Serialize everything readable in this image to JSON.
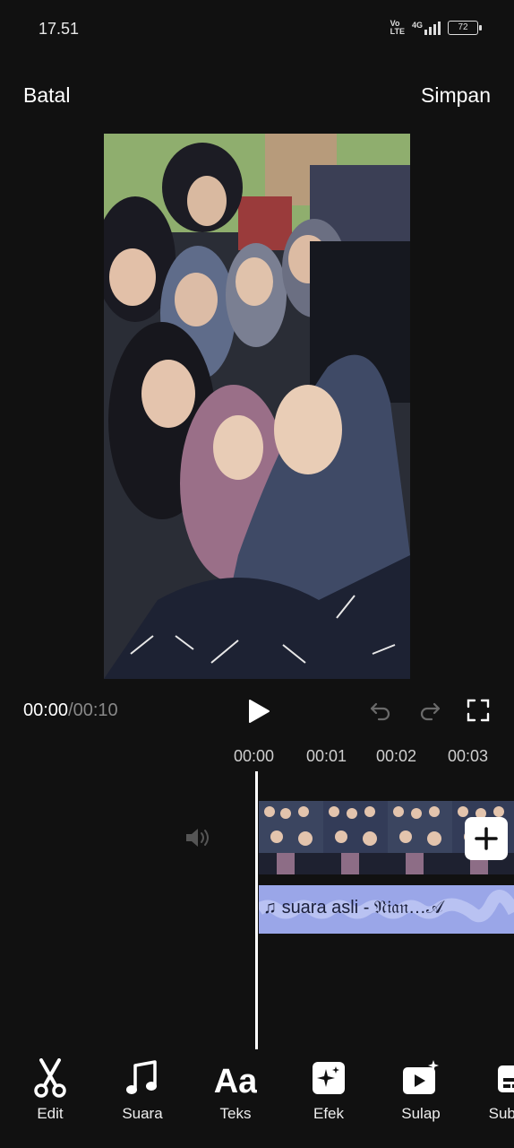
{
  "status": {
    "time": "17.51",
    "net_top": "Vo",
    "net_bottom": "LTE",
    "signal": "4G",
    "battery": "72"
  },
  "header": {
    "cancel_label": "Batal",
    "save_label": "Simpan"
  },
  "player": {
    "current": "00:00",
    "separator": "/",
    "total": "00:10"
  },
  "ruler": [
    "00:00",
    "00:01",
    "00:02",
    "00:03"
  ],
  "audio": {
    "label": "suara asli - 𝔑𝔦𝔞𝔫…𝒜"
  },
  "toolbar": {
    "items": [
      {
        "label": "Edit",
        "icon": "scissors-icon"
      },
      {
        "label": "Suara",
        "icon": "music-note-icon"
      },
      {
        "label": "Teks",
        "icon": "text-aa-icon"
      },
      {
        "label": "Efek",
        "icon": "sparkle-icon"
      },
      {
        "label": "Sulap",
        "icon": "magic-video-icon"
      },
      {
        "label": "Subtitle",
        "icon": "subtitle-icon"
      }
    ]
  },
  "colors": {
    "background": "#111111",
    "audio_track": "#9aa6e8",
    "text": "#ffffff"
  }
}
